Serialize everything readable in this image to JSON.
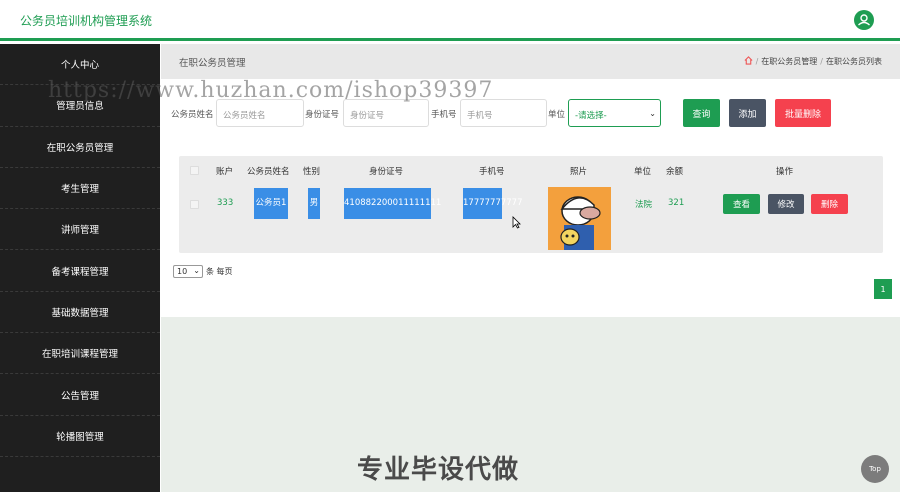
{
  "app": {
    "title": "公务员培训机构管理系统"
  },
  "sidebar": {
    "items": [
      {
        "label": "个人中心"
      },
      {
        "label": "管理员信息"
      },
      {
        "label": "在职公务员管理"
      },
      {
        "label": "考生管理"
      },
      {
        "label": "讲师管理"
      },
      {
        "label": "备考课程管理"
      },
      {
        "label": "基础数据管理"
      },
      {
        "label": "在职培训课程管理"
      },
      {
        "label": "公告管理"
      },
      {
        "label": "轮播图管理"
      }
    ]
  },
  "breadcrumb": {
    "page_title": "在职公务员管理",
    "path": [
      "在职公务员管理",
      "在职公务员列表"
    ]
  },
  "search": {
    "name_label": "公务员姓名",
    "name_placeholder": "公务员姓名",
    "id_label": "身份证号",
    "id_placeholder": "身份证号",
    "phone_label": "手机号",
    "phone_placeholder": "手机号",
    "unit_label": "单位",
    "unit_value": "-请选择-",
    "query_button": "查询",
    "add_button": "添加",
    "batch_delete_button": "批量删除"
  },
  "table": {
    "headers": [
      "账户",
      "公务员姓名",
      "性别",
      "身份证号",
      "手机号",
      "照片",
      "单位",
      "余额",
      "操作"
    ],
    "rows": [
      {
        "account": "333",
        "name": "公务员1",
        "gender": "男",
        "id_number": "410882200011111111",
        "phone": "17777777777",
        "unit": "法院",
        "balance": "321",
        "actions": {
          "view": "查看",
          "edit": "修改",
          "delete": "删除"
        }
      }
    ]
  },
  "pager": {
    "page_size": "10",
    "per_page_label": "条 每页",
    "current_page": "1"
  },
  "overlay": {
    "watermark": "https://www.huzhan.com/ishop39397",
    "ad_text": "专业毕设代做",
    "top_button": "Top"
  },
  "colors": {
    "brand": "#1e9d52",
    "danger": "#f5414e",
    "dark": "#4a5464",
    "highlight": "#3a8ee6"
  }
}
